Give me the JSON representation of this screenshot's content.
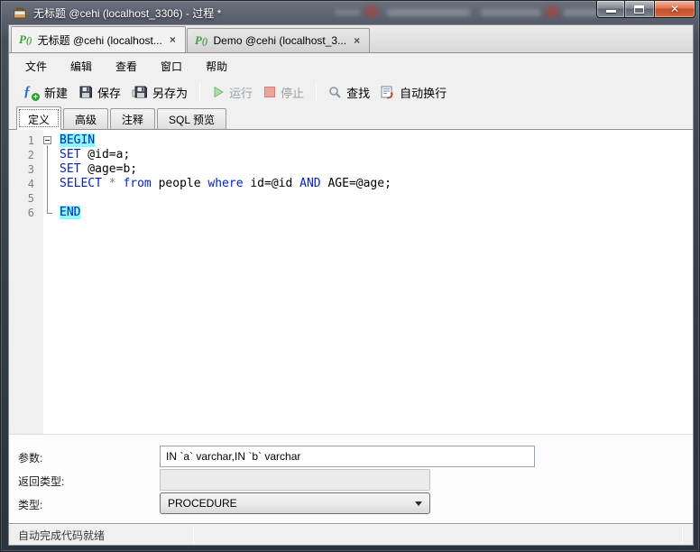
{
  "window": {
    "title": "无标题 @cehi (localhost_3306) - 过程 *",
    "app_icon": "toolbox-icon"
  },
  "doc_tabs": [
    {
      "name": "doc-tab-untitled",
      "icon": "procedure-icon",
      "label": "无标题 @cehi (localhost...",
      "close": "×",
      "active": true
    },
    {
      "name": "doc-tab-demo",
      "icon": "procedure-icon",
      "label": "Demo @cehi (localhost_3...",
      "close": "×",
      "active": false
    }
  ],
  "menu": {
    "items": [
      {
        "name": "menu-file",
        "label": "文件"
      },
      {
        "name": "menu-edit",
        "label": "编辑"
      },
      {
        "name": "menu-view",
        "label": "查看"
      },
      {
        "name": "menu-window",
        "label": "窗口"
      },
      {
        "name": "menu-help",
        "label": "帮助"
      }
    ]
  },
  "toolbar": {
    "items": [
      {
        "name": "new-button",
        "icon": "function-new-icon",
        "label": "新建",
        "disabled": false
      },
      {
        "name": "save-button",
        "icon": "save-icon",
        "label": "保存",
        "disabled": false
      },
      {
        "name": "save-as-button",
        "icon": "save-as-icon",
        "label": "另存为",
        "disabled": false
      },
      {
        "sep": true
      },
      {
        "name": "run-button",
        "icon": "run-icon",
        "label": "运行",
        "disabled": true
      },
      {
        "name": "stop-button",
        "icon": "stop-icon",
        "label": "停止",
        "disabled": true
      },
      {
        "sep": true
      },
      {
        "name": "find-button",
        "icon": "search-icon",
        "label": "查找",
        "disabled": false
      },
      {
        "name": "word-wrap-button",
        "icon": "word-wrap-icon",
        "label": "自动换行",
        "disabled": false
      }
    ]
  },
  "subtabs": {
    "items": [
      {
        "name": "tab-definition",
        "label": "定义",
        "active": true
      },
      {
        "name": "tab-advanced",
        "label": "高级",
        "active": false
      },
      {
        "name": "tab-comment",
        "label": "注释",
        "active": false
      },
      {
        "name": "tab-sql-preview",
        "label": "SQL 预览",
        "active": false
      }
    ]
  },
  "editor": {
    "lines": [
      {
        "num": "1",
        "fold": "start",
        "segments": [
          {
            "t": "BEGIN",
            "c": "kw",
            "hl": true
          }
        ]
      },
      {
        "num": "2",
        "fold": "mid",
        "segments": [
          {
            "t": "SET",
            "c": "kw"
          },
          {
            "t": " @id=a;",
            "c": "plain"
          }
        ]
      },
      {
        "num": "3",
        "fold": "mid",
        "segments": [
          {
            "t": "SET",
            "c": "kw"
          },
          {
            "t": " @age=b;",
            "c": "plain"
          }
        ]
      },
      {
        "num": "4",
        "fold": "mid",
        "segments": [
          {
            "t": "SELECT",
            "c": "kw"
          },
          {
            "t": " ",
            "c": "plain"
          },
          {
            "t": "*",
            "c": "op"
          },
          {
            "t": " ",
            "c": "plain"
          },
          {
            "t": "from",
            "c": "kw"
          },
          {
            "t": " people ",
            "c": "plain"
          },
          {
            "t": "where",
            "c": "kw"
          },
          {
            "t": " id=@id ",
            "c": "plain"
          },
          {
            "t": "AND",
            "c": "kw"
          },
          {
            "t": " AGE=@age;",
            "c": "plain"
          }
        ]
      },
      {
        "num": "5",
        "fold": "mid",
        "segments": []
      },
      {
        "num": "6",
        "fold": "end",
        "segments": [
          {
            "t": "END",
            "c": "kw",
            "hl": true
          }
        ]
      }
    ]
  },
  "form": {
    "param_label": "参数:",
    "param_value": "IN `a` varchar,IN `b` varchar",
    "return_label": "返回类型:",
    "return_value": "",
    "type_label": "类型:",
    "type_value": "PROCEDURE"
  },
  "statusbar": {
    "text": "自动完成代码就绪"
  },
  "colors": {
    "keyword": "#0021cd",
    "bracket_highlight": "#8bf7f7",
    "procedure_icon_green": "#3fa03c",
    "close_button_red": "#c4502a"
  }
}
